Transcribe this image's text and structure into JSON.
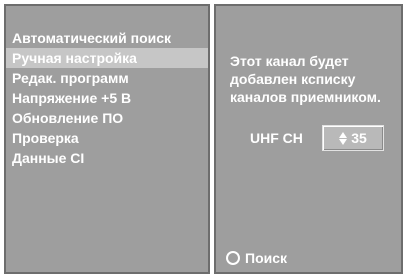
{
  "menu": {
    "items": [
      {
        "label": "Автоматический поиск"
      },
      {
        "label": "Ручная настройка",
        "selected": true
      },
      {
        "label": "Редак. программ"
      },
      {
        "label": "Напряжение +5 В"
      },
      {
        "label": "Обновление ПО"
      },
      {
        "label": "Проверка"
      },
      {
        "label": "Данные CI"
      }
    ]
  },
  "details": {
    "message_lines": [
      "Этот канал будет",
      "добавлен ксписку",
      "каналов приемником."
    ],
    "channel": {
      "label": "UHF CH",
      "value": "35",
      "icon": "up-down-stepper-icon"
    },
    "search": {
      "label": "Поиск",
      "icon": "circle-button-icon"
    }
  },
  "colors": {
    "panel_bg": "#9e9e9e",
    "selected_bg": "#c6c6c6",
    "text": "#ffffff"
  }
}
